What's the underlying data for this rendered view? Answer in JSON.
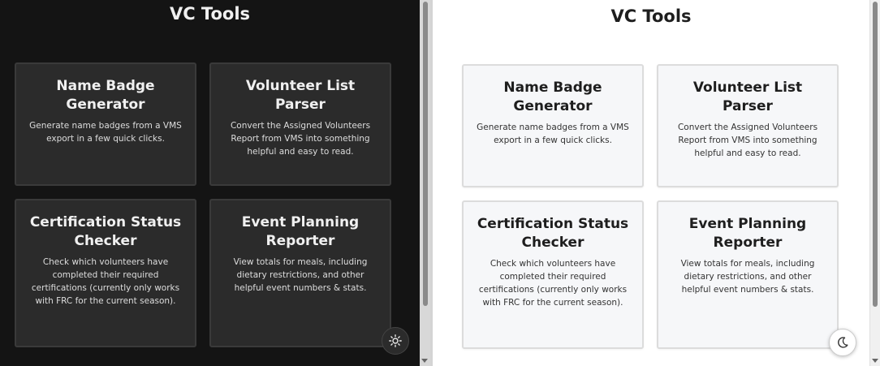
{
  "app": {
    "title": "VC Tools"
  },
  "cards": [
    {
      "title": "Name Badge Generator",
      "description": "Generate name badges from a VMS export in a few quick clicks."
    },
    {
      "title": "Volunteer List Parser",
      "description": "Convert the Assigned Volunteers Report from VMS into something helpful and easy to read."
    },
    {
      "title": "Certification Status Checker",
      "description": "Check which volunteers have completed their required certifications (currently only works with FRC for the current season)."
    },
    {
      "title": "Event Planning Reporter",
      "description": "View totals for meals, including dietary restrictions, and other helpful event numbers & stats."
    }
  ],
  "theme": {
    "dark": {
      "background": "#141414",
      "card": "#2b2b2b",
      "toggle_icon": "sun-icon"
    },
    "light": {
      "background": "#ffffff",
      "card": "#f6f7f9",
      "toggle_icon": "moon-icon"
    }
  }
}
